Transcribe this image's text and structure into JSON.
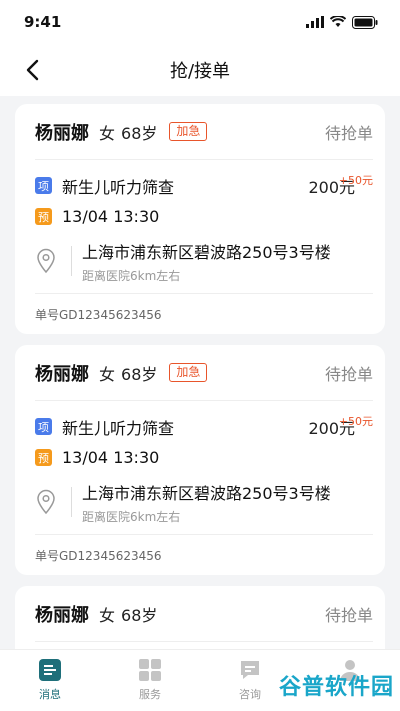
{
  "status_bar": {
    "time": "9:41"
  },
  "nav": {
    "title": "抢/接单"
  },
  "orders": [
    {
      "name": "杨丽娜",
      "gender": "女",
      "age": "68岁",
      "urgent_label": "加急",
      "status": "待抢单",
      "service_tag": "项",
      "service": "新生儿听力筛查",
      "price": "200元",
      "bonus": "+50元",
      "time_tag": "预",
      "time": "13/04 13:30",
      "address": "上海市浦东新区碧波路250号3号楼",
      "distance": "距离医院6km左右",
      "order_no": "单号GD12345623456"
    },
    {
      "name": "杨丽娜",
      "gender": "女",
      "age": "68岁",
      "urgent_label": "加急",
      "status": "待抢单",
      "service_tag": "项",
      "service": "新生儿听力筛查",
      "price": "200元",
      "bonus": "+50元",
      "time_tag": "预",
      "time": "13/04 13:30",
      "address": "上海市浦东新区碧波路250号3号楼",
      "distance": "距离医院6km左右",
      "order_no": "单号GD12345623456"
    },
    {
      "name": "杨丽娜",
      "gender": "女",
      "age": "68岁",
      "status": "待抢单"
    }
  ],
  "tabbar": {
    "items": [
      {
        "label": "消息",
        "icon": "message-icon"
      },
      {
        "label": "服务",
        "icon": "grid-icon"
      },
      {
        "label": "咨询",
        "icon": "chat-icon"
      },
      {
        "label": "",
        "icon": "profile-icon"
      }
    ]
  },
  "watermark": "谷普软件园",
  "colors": {
    "accent": "#1e6f7a",
    "urgent": "#e8552b",
    "tag_blue": "#4a7bea",
    "tag_orange": "#f59a1c"
  }
}
